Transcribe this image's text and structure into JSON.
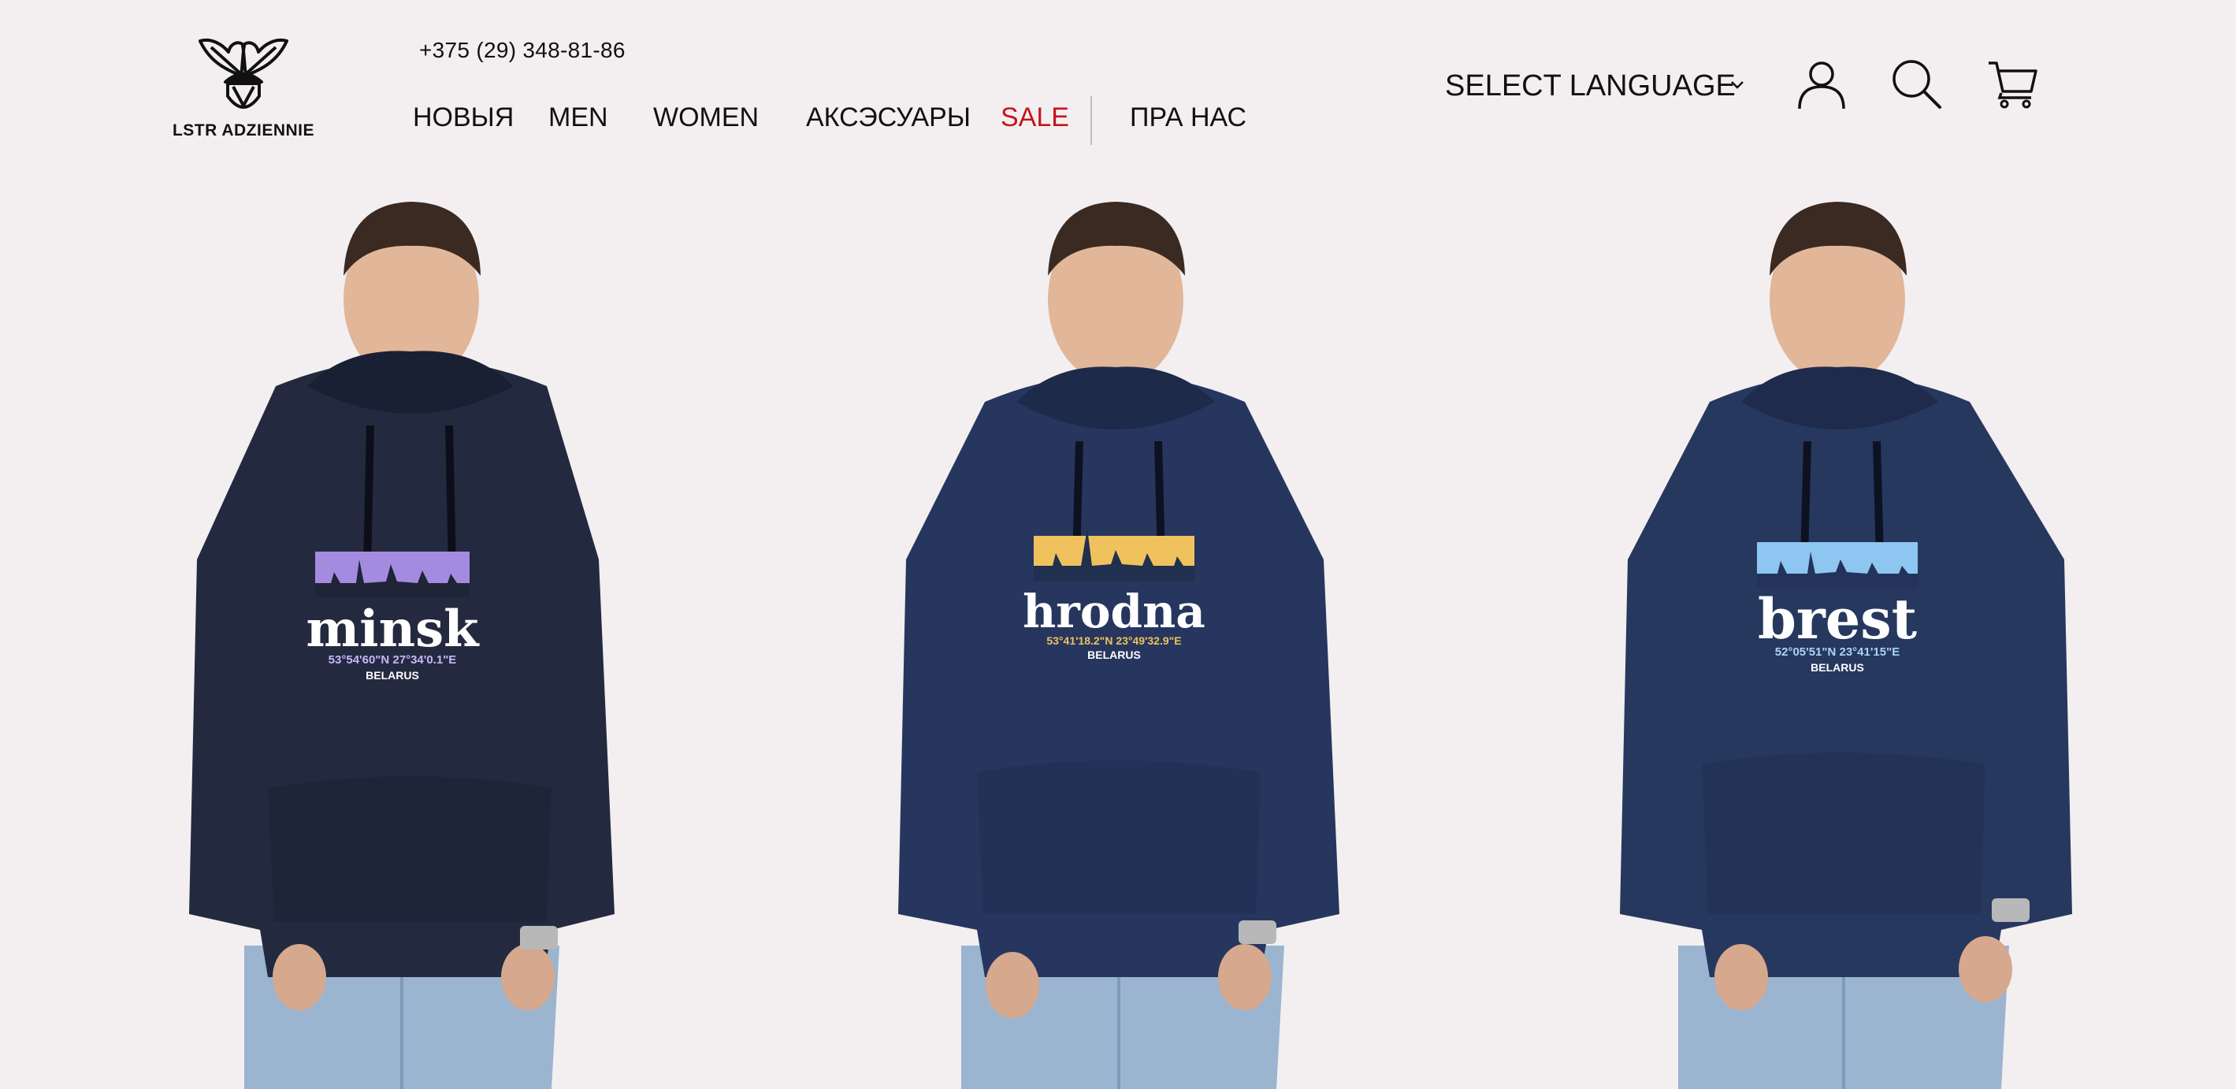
{
  "brand": {
    "name": "LSTR ADZIENNIE"
  },
  "header": {
    "phone": "+375 (29)  348-81-86",
    "nav": [
      {
        "label": "НОВЫЯ"
      },
      {
        "label": "MEN"
      },
      {
        "label": "WOMEN"
      },
      {
        "label": "АКСЭСУАРЫ"
      },
      {
        "label": "SALE",
        "color": "#c4141b"
      },
      {
        "label": "ПРА НАС"
      }
    ],
    "language": {
      "label": "SELECT LANGUAGE",
      "icon": "chevron-down-icon"
    },
    "icons": [
      "user-icon",
      "search-icon",
      "cart-icon"
    ]
  },
  "products": [
    {
      "print_city": "minsk",
      "print_coords": "53°54'60\"N  27°34'0.1\"E",
      "print_country": "BELARUS",
      "hoodie_color": "#232a40",
      "skyline_color": "#a58be0",
      "coords_color": "#c7b6f5"
    },
    {
      "print_city": "hrodna",
      "print_coords": "53°41'18.2\"N 23°49'32.9\"E",
      "print_country": "BELARUS",
      "hoodie_color": "#26365e",
      "skyline_color": "#f0c25e",
      "coords_color": "#f0c25e"
    },
    {
      "print_city": "brest",
      "print_coords": "52°05'51\"N  23°41'15\"E",
      "print_country": "BELARUS",
      "hoodie_color": "#27385f",
      "skyline_color": "#8dc6f0",
      "coords_color": "#a8d4f5"
    }
  ]
}
